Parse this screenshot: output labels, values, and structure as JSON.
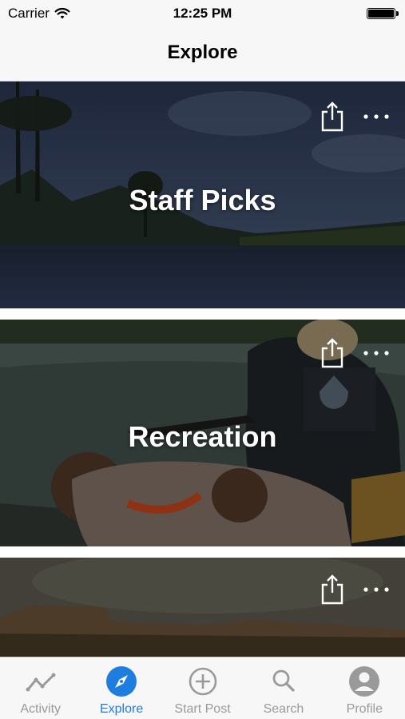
{
  "status_bar": {
    "carrier": "Carrier",
    "time": "12:25 PM",
    "wifi_icon": "wifi-icon",
    "battery_level": 1.0
  },
  "nav": {
    "title": "Explore"
  },
  "cards": [
    {
      "title": "Staff Picks",
      "share_icon": "share-icon",
      "more_icon": "more-icon"
    },
    {
      "title": "Recreation",
      "share_icon": "share-icon",
      "more_icon": "more-icon"
    },
    {
      "title": "",
      "share_icon": "share-icon",
      "more_icon": "more-icon"
    }
  ],
  "tabs": [
    {
      "label": "Activity",
      "icon": "activity-icon",
      "active": false
    },
    {
      "label": "Explore",
      "icon": "compass-icon",
      "active": true
    },
    {
      "label": "Start Post",
      "icon": "plus-circle-icon",
      "active": false
    },
    {
      "label": "Search",
      "icon": "search-icon",
      "active": false
    },
    {
      "label": "Profile",
      "icon": "profile-icon",
      "active": false
    }
  ],
  "colors": {
    "accent": "#1f7de0",
    "tab_inactive": "#9a9a9a",
    "bar_background": "#f7f7f7"
  }
}
